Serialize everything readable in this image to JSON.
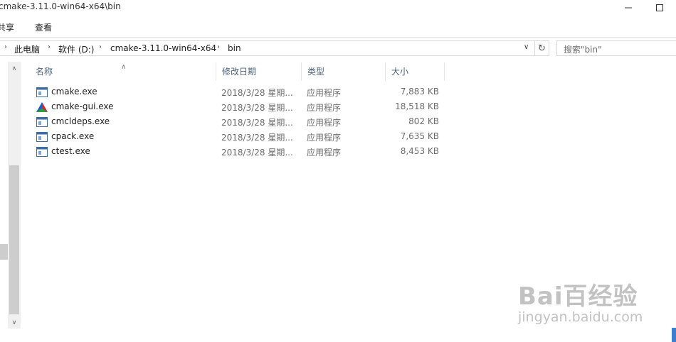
{
  "window": {
    "title": "cmake-3.11.0-win64-x64\\bin"
  },
  "ribbon": {
    "tabs": [
      "共享",
      "查看"
    ]
  },
  "address": {
    "crumbs": [
      "此电脑",
      "软件 (D:)",
      "cmake-3.11.0-win64-x64",
      "bin"
    ]
  },
  "search": {
    "placeholder": "搜索\"bin\""
  },
  "columns": {
    "name": "名称",
    "date": "修改日期",
    "type": "类型",
    "size": "大小"
  },
  "files": [
    {
      "name": "cmake.exe",
      "date": "2018/3/28 星期...",
      "type": "应用程序",
      "size": "7,883 KB",
      "icon": "exe-window-icon"
    },
    {
      "name": "cmake-gui.exe",
      "date": "2018/3/28 星期...",
      "type": "应用程序",
      "size": "18,518 KB",
      "icon": "cmake-triangle-icon"
    },
    {
      "name": "cmcldeps.exe",
      "date": "2018/3/28 星期...",
      "type": "应用程序",
      "size": "802 KB",
      "icon": "exe-window-icon"
    },
    {
      "name": "cpack.exe",
      "date": "2018/3/28 星期...",
      "type": "应用程序",
      "size": "7,635 KB",
      "icon": "exe-window-icon"
    },
    {
      "name": "ctest.exe",
      "date": "2018/3/28 星期...",
      "type": "应用程序",
      "size": "8,453 KB",
      "icon": "exe-window-icon"
    }
  ],
  "watermark": {
    "main": "Bai百经验",
    "sub": "jingyan.baidu.com"
  }
}
